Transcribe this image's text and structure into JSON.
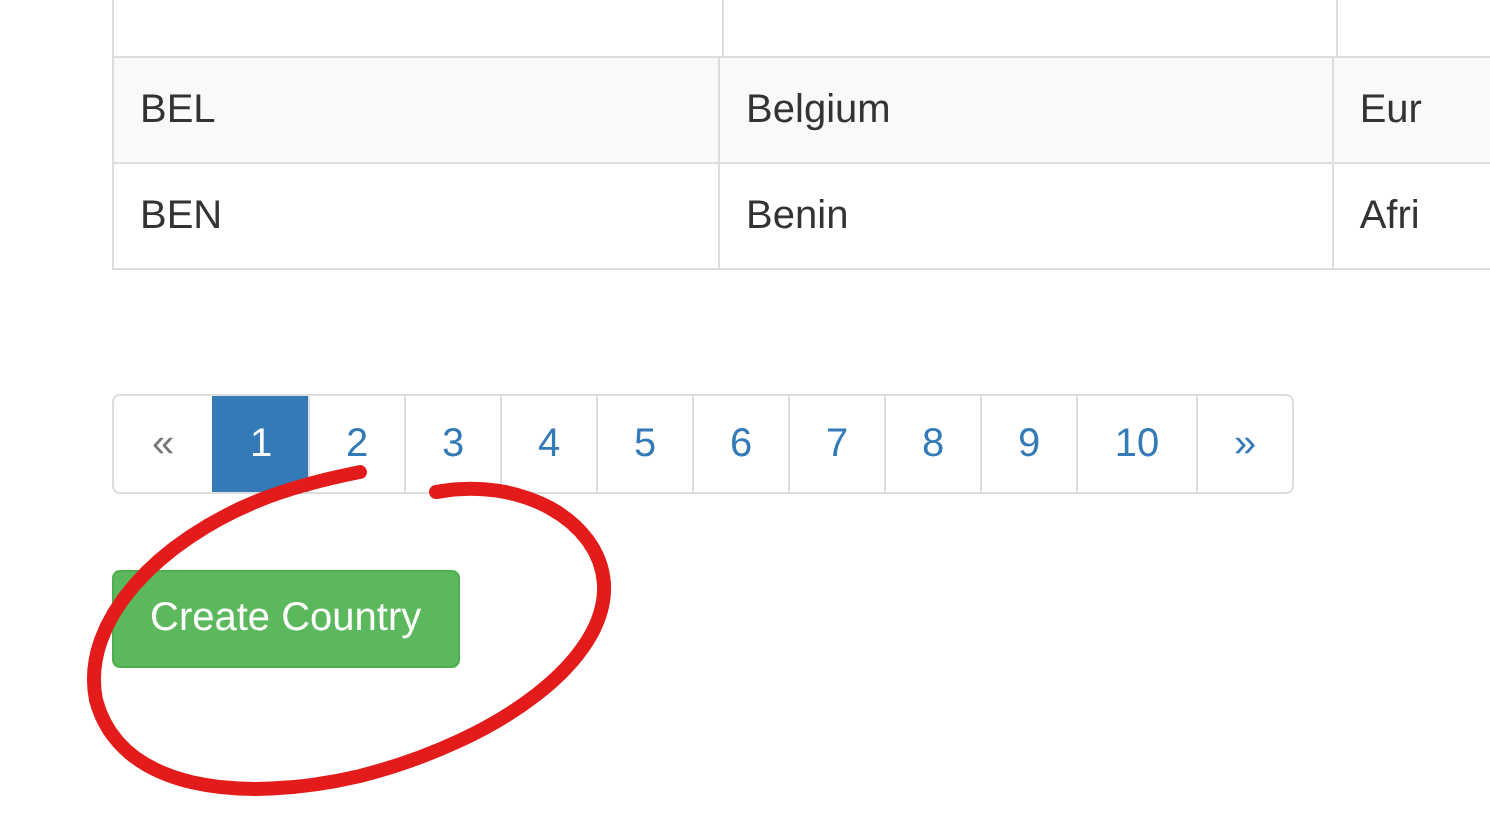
{
  "table": {
    "rows": [
      {
        "cells": [
          "BEL",
          "Belgium",
          "Eur"
        ]
      },
      {
        "cells": [
          "BEN",
          "Benin",
          "Afri"
        ]
      }
    ]
  },
  "pagination": {
    "items": [
      {
        "label": "«",
        "selected": false
      },
      {
        "label": "1",
        "selected": true
      },
      {
        "label": "2",
        "selected": false
      },
      {
        "label": "3",
        "selected": false
      },
      {
        "label": "4",
        "selected": false
      },
      {
        "label": "5",
        "selected": false
      },
      {
        "label": "6",
        "selected": false
      },
      {
        "label": "7",
        "selected": false
      },
      {
        "label": "8",
        "selected": false
      },
      {
        "label": "9",
        "selected": false
      },
      {
        "label": "10",
        "selected": false
      },
      {
        "label": "»",
        "selected": false
      }
    ]
  },
  "create_button": {
    "label": "Create Country"
  }
}
